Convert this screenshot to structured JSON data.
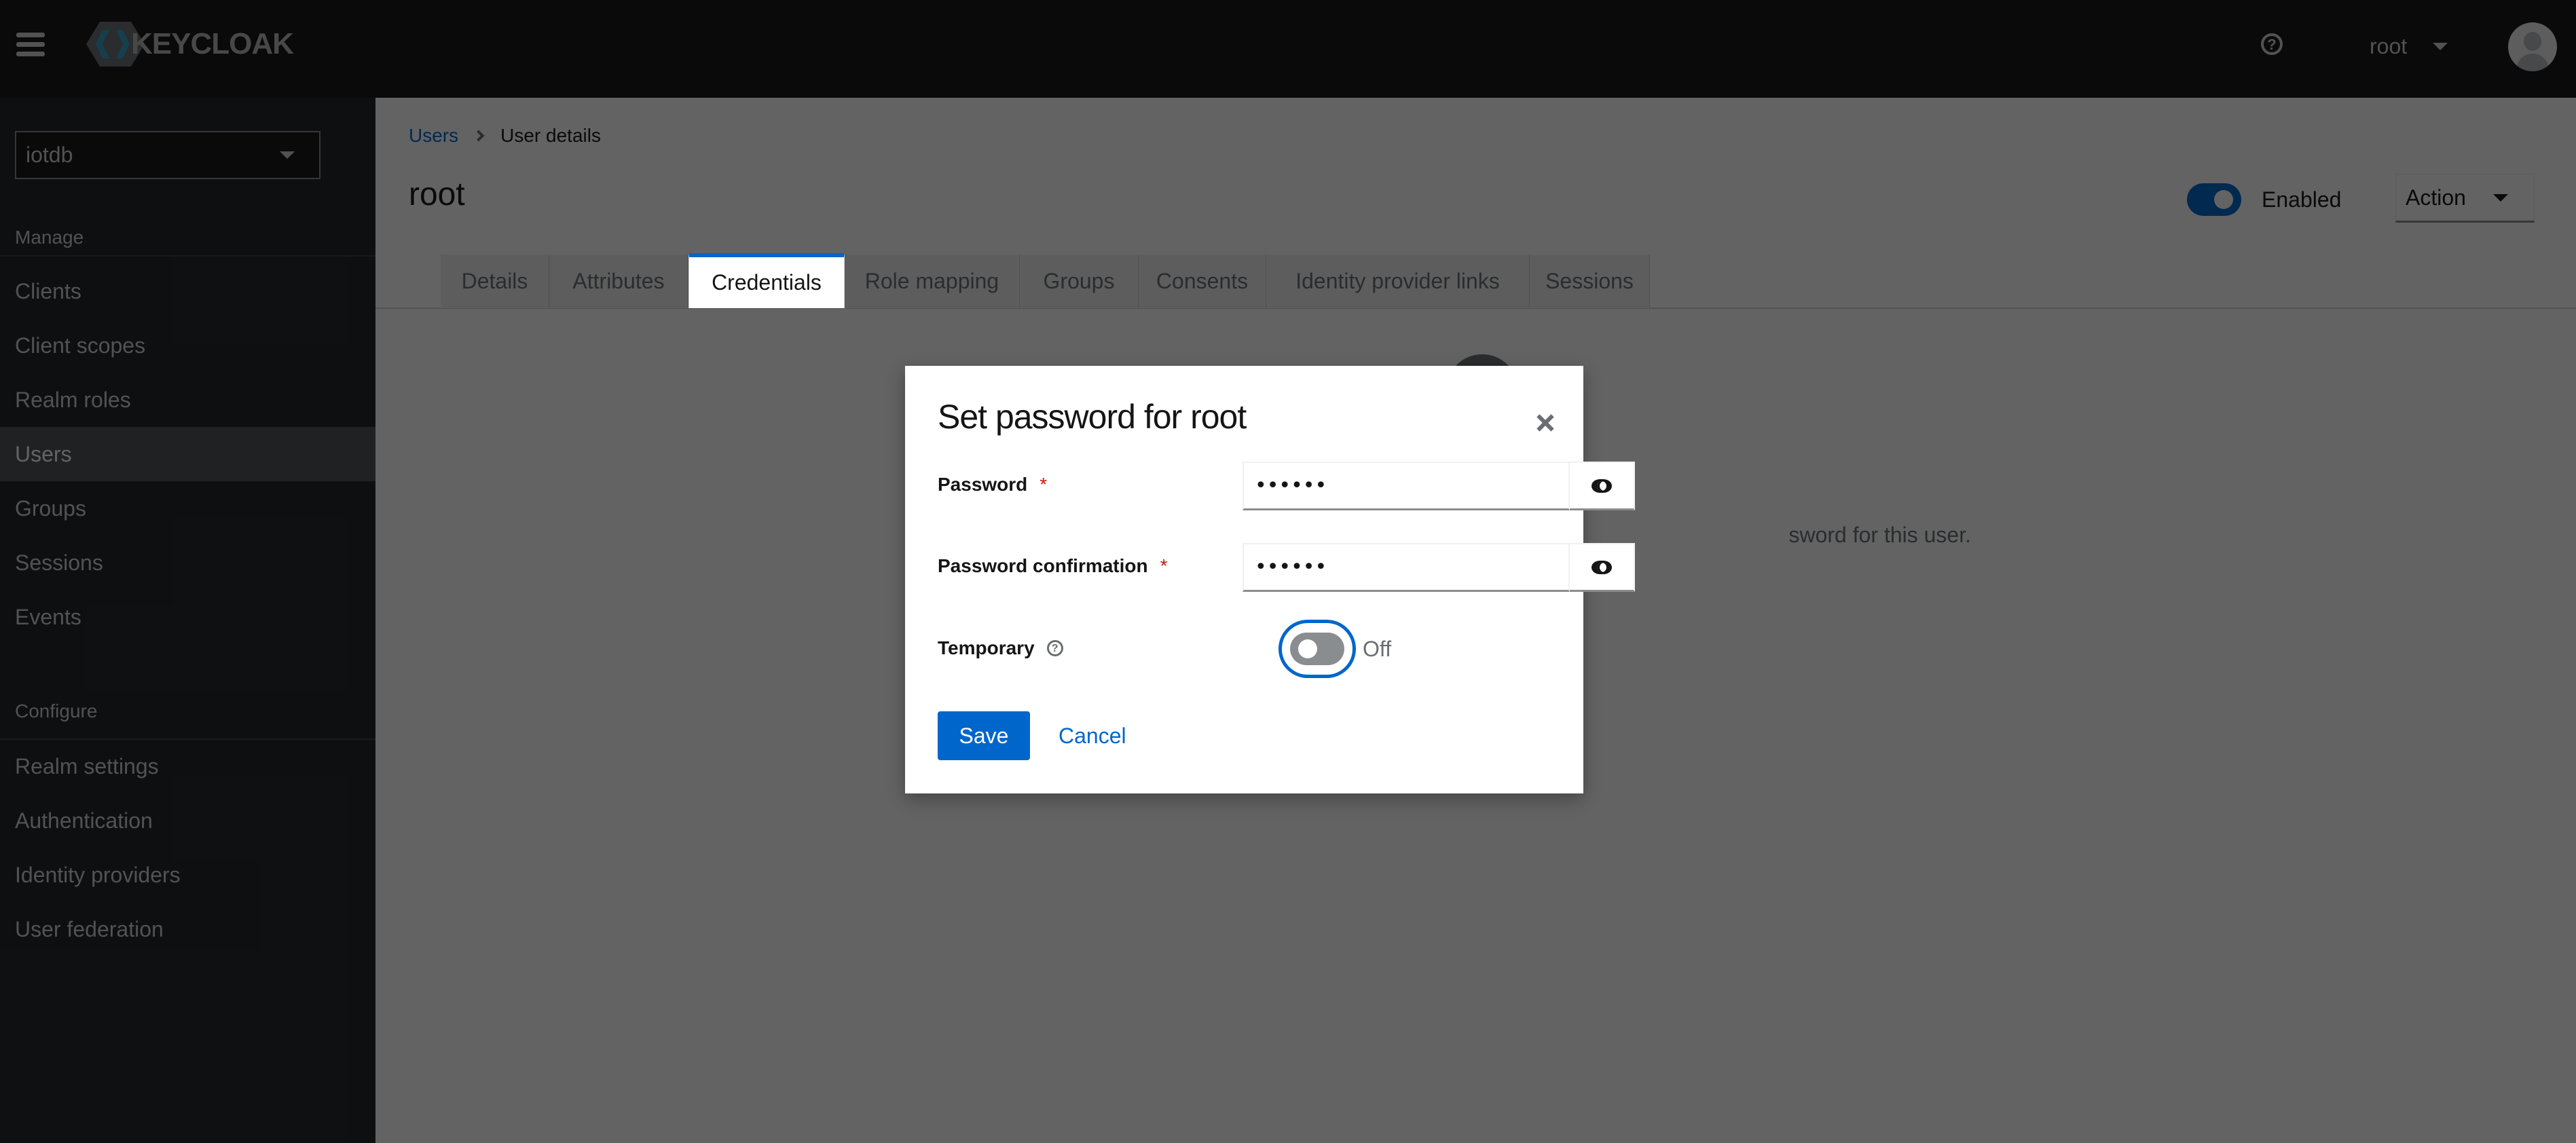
{
  "header": {
    "brand": "KEYCLOAK",
    "user_name": "root",
    "icons": {
      "menu": "hamburger-icon",
      "help": "help-icon",
      "avatar": "user-avatar-icon"
    }
  },
  "sidebar": {
    "realm": "iotdb",
    "groups": [
      {
        "title": "Manage",
        "items": [
          {
            "label": "Clients",
            "active": false
          },
          {
            "label": "Client scopes",
            "active": false
          },
          {
            "label": "Realm roles",
            "active": false
          },
          {
            "label": "Users",
            "active": true
          },
          {
            "label": "Groups",
            "active": false
          },
          {
            "label": "Sessions",
            "active": false
          },
          {
            "label": "Events",
            "active": false
          }
        ]
      },
      {
        "title": "Configure",
        "items": [
          {
            "label": "Realm settings",
            "active": false
          },
          {
            "label": "Authentication",
            "active": false
          },
          {
            "label": "Identity providers",
            "active": false
          },
          {
            "label": "User federation",
            "active": false
          }
        ]
      }
    ]
  },
  "main": {
    "breadcrumb": {
      "parent": "Users",
      "current": "User details"
    },
    "title": "root",
    "enabled_label": "Enabled",
    "enabled": true,
    "action_label": "Action",
    "tabs": [
      {
        "label": "Details",
        "active": false
      },
      {
        "label": "Attributes",
        "active": false
      },
      {
        "label": "Credentials",
        "active": true
      },
      {
        "label": "Role mapping",
        "active": false
      },
      {
        "label": "Groups",
        "active": false
      },
      {
        "label": "Consents",
        "active": false
      },
      {
        "label": "Identity provider links",
        "active": false
      },
      {
        "label": "Sessions",
        "active": false
      }
    ],
    "empty_state_text_visible": "sword for this user."
  },
  "modal": {
    "title": "Set password for root",
    "password": {
      "label": "Password",
      "required_mark": "*",
      "value": "••••••"
    },
    "password_confirmation": {
      "label": "Password confirmation",
      "required_mark": "*",
      "value": "••••••"
    },
    "temporary": {
      "label": "Temporary",
      "state_label": "Off",
      "on": false
    },
    "save_label": "Save",
    "cancel_label": "Cancel"
  },
  "colors": {
    "primary": "#0066cc",
    "required": "#c9190b",
    "header_bg": "#151515",
    "sidebar_bg": "#212427"
  }
}
